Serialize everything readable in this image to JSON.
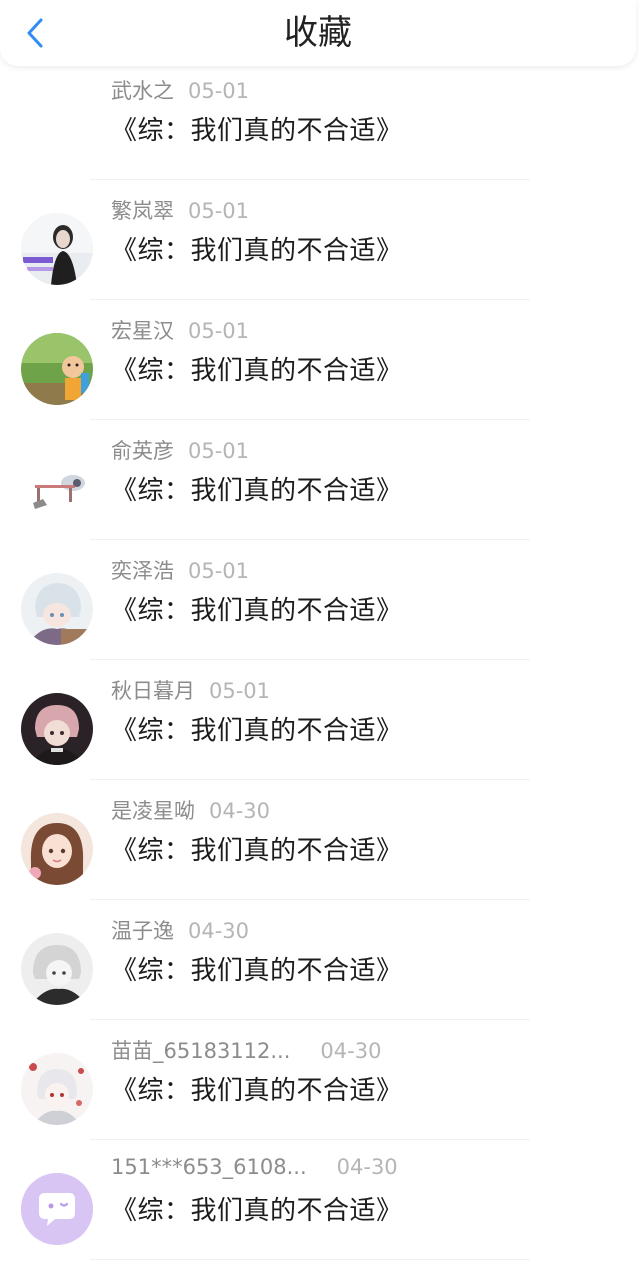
{
  "header": {
    "title": "收藏",
    "back_icon": "chevron-left-icon",
    "accent_color": "#2f8cf5"
  },
  "items": [
    {
      "name": "武水之",
      "date": "05-01",
      "book": "《综：我们真的不合适》",
      "avatar": "none"
    },
    {
      "name": "繁岚翠",
      "date": "05-01",
      "book": "《综：我们真的不合适》",
      "avatar": "photo-girl-gray"
    },
    {
      "name": "宏星汉",
      "date": "05-01",
      "book": "《综：我们真的不合适》",
      "avatar": "cartoon-green"
    },
    {
      "name": "俞英彦",
      "date": "05-01",
      "book": "《综：我们真的不合适》",
      "avatar": "sketch-white"
    },
    {
      "name": "奕泽浩",
      "date": "05-01",
      "book": "《综：我们真的不合适》",
      "avatar": "anime-silver"
    },
    {
      "name": "秋日暮月",
      "date": "05-01",
      "book": "《综：我们真的不合适》",
      "avatar": "anime-dark-pink"
    },
    {
      "name": "是凌星呦",
      "date": "04-30",
      "book": "《综：我们真的不合适》",
      "avatar": "anime-girl-warm"
    },
    {
      "name": "温子逸",
      "date": "04-30",
      "book": "《综：我们真的不合适》",
      "avatar": "anime-gray"
    },
    {
      "name": "苗苗_65183112...",
      "date": "04-30",
      "book": "《综：我们真的不合适》",
      "avatar": "anime-white-red"
    },
    {
      "name": "151***653_6108...",
      "date": "04-30",
      "book": "《综：我们真的不合适》",
      "avatar": "default-chat-purple"
    }
  ]
}
